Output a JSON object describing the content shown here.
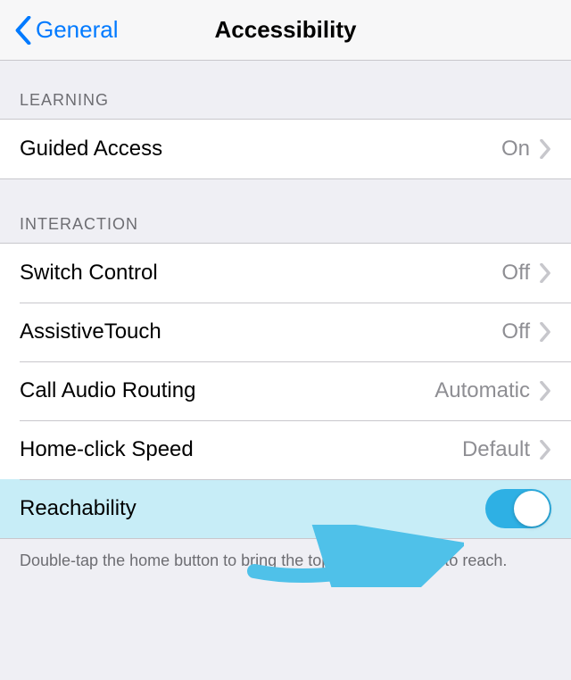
{
  "nav": {
    "back_label": "General",
    "title": "Accessibility"
  },
  "sections": {
    "learning": {
      "header": "LEARNING",
      "guided_access": {
        "label": "Guided Access",
        "value": "On"
      }
    },
    "interaction": {
      "header": "INTERACTION",
      "switch_control": {
        "label": "Switch Control",
        "value": "Off"
      },
      "assistive_touch": {
        "label": "AssistiveTouch",
        "value": "Off"
      },
      "call_audio_routing": {
        "label": "Call Audio Routing",
        "value": "Automatic"
      },
      "home_click_speed": {
        "label": "Home-click Speed",
        "value": "Default"
      },
      "reachability": {
        "label": "Reachability",
        "toggle_on": true
      }
    }
  },
  "footer": "Double-tap the home button to bring the top of the screen into reach.",
  "colors": {
    "accent": "#007aff",
    "highlight_row": "#c7edf7",
    "toggle_on": "#2eb0e4",
    "annotation_arrow": "#4fc1e9"
  }
}
